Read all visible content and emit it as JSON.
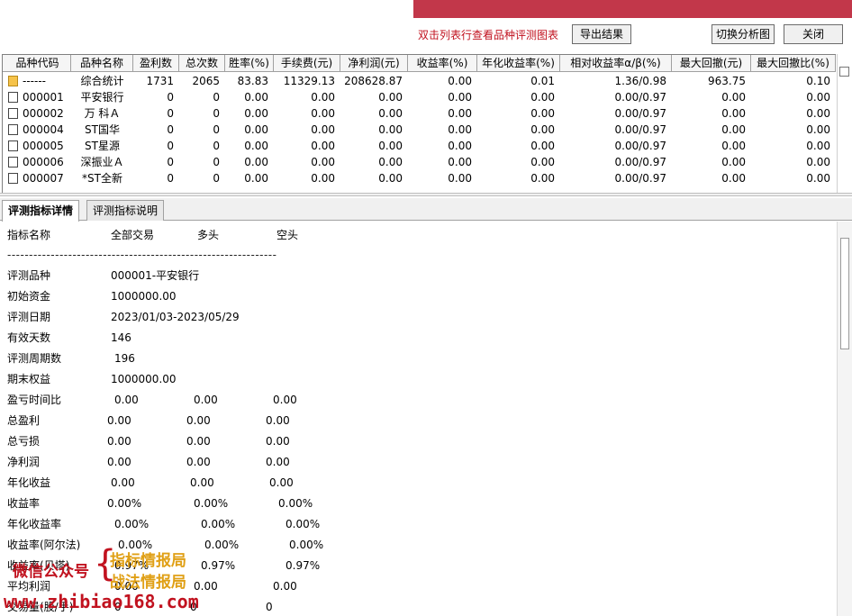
{
  "toolbar": {
    "hint": "双击列表行查看品种评测图表",
    "export_label": "导出结果",
    "switch_label": "切换分析图",
    "close_label": "关闭"
  },
  "table": {
    "headers": [
      "品种代码",
      "品种名称",
      "盈利数",
      "总次数",
      "胜率(%)",
      "手续费(元)",
      "净利润(元)",
      "收益率(%)",
      "年化收益率(%)",
      "相对收益率α/β(%)",
      "最大回撤(元)",
      "最大回撤比(%)"
    ],
    "rows": [
      {
        "code": "------",
        "name": "综合统计",
        "win": "1731",
        "total": "2065",
        "rate": "83.83",
        "fee": "11329.13",
        "profit": "208628.87",
        "ret": "0.00",
        "annual": "0.01",
        "ab": "1.36/0.98",
        "dd": "963.75",
        "ddr": "0.10",
        "icon": "folder-icon"
      },
      {
        "code": "000001",
        "name": "平安银行",
        "win": "0",
        "total": "0",
        "rate": "0.00",
        "fee": "0.00",
        "profit": "0.00",
        "ret": "0.00",
        "annual": "0.00",
        "ab": "0.00/0.97",
        "dd": "0.00",
        "ddr": "0.00",
        "icon": "page-icon"
      },
      {
        "code": "000002",
        "name": "万 科Ａ",
        "win": "0",
        "total": "0",
        "rate": "0.00",
        "fee": "0.00",
        "profit": "0.00",
        "ret": "0.00",
        "annual": "0.00",
        "ab": "0.00/0.97",
        "dd": "0.00",
        "ddr": "0.00",
        "icon": "page-icon"
      },
      {
        "code": "000004",
        "name": "ST国华",
        "win": "0",
        "total": "0",
        "rate": "0.00",
        "fee": "0.00",
        "profit": "0.00",
        "ret": "0.00",
        "annual": "0.00",
        "ab": "0.00/0.97",
        "dd": "0.00",
        "ddr": "0.00",
        "icon": "page-icon"
      },
      {
        "code": "000005",
        "name": "ST星源",
        "win": "0",
        "total": "0",
        "rate": "0.00",
        "fee": "0.00",
        "profit": "0.00",
        "ret": "0.00",
        "annual": "0.00",
        "ab": "0.00/0.97",
        "dd": "0.00",
        "ddr": "0.00",
        "icon": "page-icon"
      },
      {
        "code": "000006",
        "name": "深振业Ａ",
        "win": "0",
        "total": "0",
        "rate": "0.00",
        "fee": "0.00",
        "profit": "0.00",
        "ret": "0.00",
        "annual": "0.00",
        "ab": "0.00/0.97",
        "dd": "0.00",
        "ddr": "0.00",
        "icon": "page-icon"
      },
      {
        "code": "000007",
        "name": "*ST全新",
        "win": "0",
        "total": "0",
        "rate": "0.00",
        "fee": "0.00",
        "profit": "0.00",
        "ret": "0.00",
        "annual": "0.00",
        "ab": "0.00/0.97",
        "dd": "0.00",
        "ddr": "0.00",
        "icon": "page-icon"
      }
    ]
  },
  "tabs": [
    {
      "label": "评测指标详情",
      "active": true
    },
    {
      "label": "评测指标说明",
      "active": false
    }
  ],
  "detail": {
    "header": {
      "name": "指标名称",
      "all": "全部交易",
      "long": "多头",
      "short": "空头"
    },
    "separator": "--------------------------------------------------------------",
    "info": [
      {
        "label": "评测品种",
        "value": "000001-平安银行"
      },
      {
        "label": "初始资金",
        "value": "1000000.00"
      },
      {
        "label": "评测日期",
        "value": "2023/01/03-2023/05/29"
      },
      {
        "label": "有效天数",
        "value": "146"
      },
      {
        "label": "评测周期数",
        "value": "196"
      },
      {
        "label": "期末权益",
        "value": "1000000.00"
      }
    ],
    "metrics": [
      {
        "label": "盈亏时间比",
        "all": "0.00",
        "long": "0.00",
        "short": "0.00"
      },
      {
        "label": "总盈利",
        "all": "0.00",
        "long": "0.00",
        "short": "0.00"
      },
      {
        "label": "总亏损",
        "all": "0.00",
        "long": "0.00",
        "short": "0.00"
      },
      {
        "label": "净利润",
        "all": "0.00",
        "long": "0.00",
        "short": "0.00"
      },
      {
        "label": "年化收益",
        "all": "0.00",
        "long": "0.00",
        "short": "0.00"
      },
      {
        "label": "收益率",
        "all": "0.00%",
        "long": "0.00%",
        "short": "0.00%"
      },
      {
        "label": "年化收益率",
        "all": "0.00%",
        "long": "0.00%",
        "short": "0.00%"
      },
      {
        "label": "收益率(阿尔法)",
        "all": "0.00%",
        "long": "0.00%",
        "short": "0.00%"
      },
      {
        "label": "收益率(贝塔)",
        "all": "0.97%",
        "long": "0.97%",
        "short": "0.97%"
      },
      {
        "label": "平均利润",
        "all": "0.00",
        "long": "0.00",
        "short": "0.00"
      },
      {
        "label": "交易量(股/手)",
        "all": "0",
        "long": "0",
        "short": "0"
      }
    ]
  },
  "watermark": {
    "wechat": "微信公众号",
    "line1": "指标情报局",
    "line2": "战法情报局",
    "url": "www.zhibiao168.com"
  },
  "colors": {
    "accent_red": "#c2374a",
    "hint_red": "#c1121f",
    "watermark_gold": "#e0a016"
  }
}
